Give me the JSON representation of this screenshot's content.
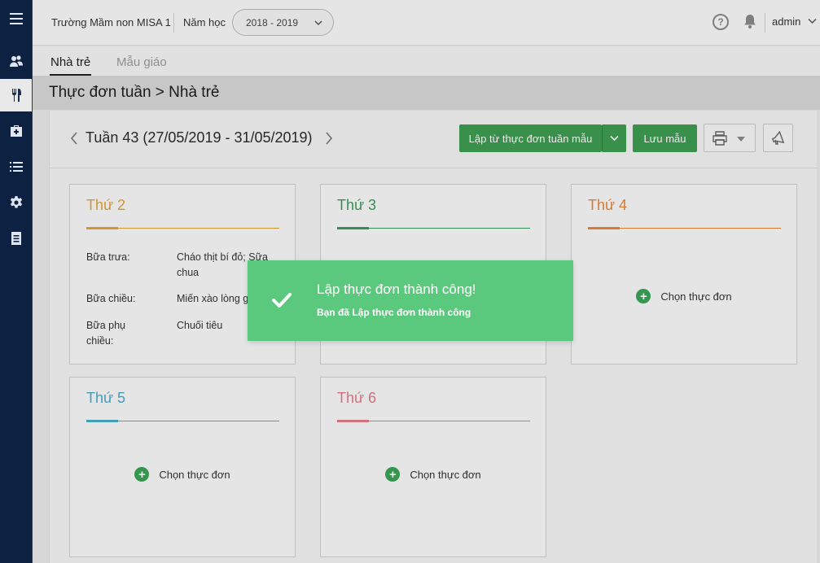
{
  "header": {
    "school_name": "Trường Mầm non MISA 1",
    "year_label": "Năm học",
    "year_value": "2018 - 2019",
    "user": "admin"
  },
  "sidebar": {
    "items": [
      {
        "icon": "menu-icon",
        "active": false
      },
      {
        "icon": "users-icon",
        "active": false
      },
      {
        "icon": "fork-knife-icon",
        "active": true
      },
      {
        "icon": "medkit-icon",
        "active": false
      },
      {
        "icon": "list-icon",
        "active": false
      },
      {
        "icon": "gear-icon",
        "active": false
      },
      {
        "icon": "document-icon",
        "active": false
      }
    ]
  },
  "tabs": [
    {
      "label": "Nhà trẻ",
      "active": true
    },
    {
      "label": "Mẫu giáo",
      "active": false
    }
  ],
  "page_title": "Thực đơn tuần > Nhà trẻ",
  "toolbar": {
    "week_label": "Tuần 43 (27/05/2019 - 31/05/2019)",
    "create_from_template": "Lập từ thực đơn tuần mẫu",
    "save_template": "Lưu mẫu"
  },
  "days": [
    {
      "name": "Thứ 2",
      "color": "#e0a23a",
      "meals": [
        {
          "label": "Bữa trưa:",
          "value": "Cháo thịt bí đỏ; Sữa chua"
        },
        {
          "label": "Bữa chiều:",
          "value": "Miến xào lòng gà"
        },
        {
          "label": "Bữa phụ chiều:",
          "value": "Chuối tiêu"
        }
      ]
    },
    {
      "name": "Thứ 3",
      "color": "#3a9a5a",
      "meals": []
    },
    {
      "name": "Thứ 4",
      "color": "#e8843a",
      "meals": [],
      "choose_label": "Chọn thực đơn"
    },
    {
      "name": "Thứ 5",
      "color": "#4aa8c8",
      "meals": [],
      "choose_label": "Chọn thực đơn"
    },
    {
      "name": "Thứ 6",
      "color": "#e07a88",
      "meals": [],
      "choose_label": "Chọn thực đơn"
    }
  ],
  "toast": {
    "title": "Lập thực đơn thành công!",
    "message": "Bạn đã Lập thực đơn thành công",
    "color": "#5bc97d"
  },
  "colors": {
    "sidebar": "#0d2142",
    "primary_green": "#3e9b50"
  }
}
